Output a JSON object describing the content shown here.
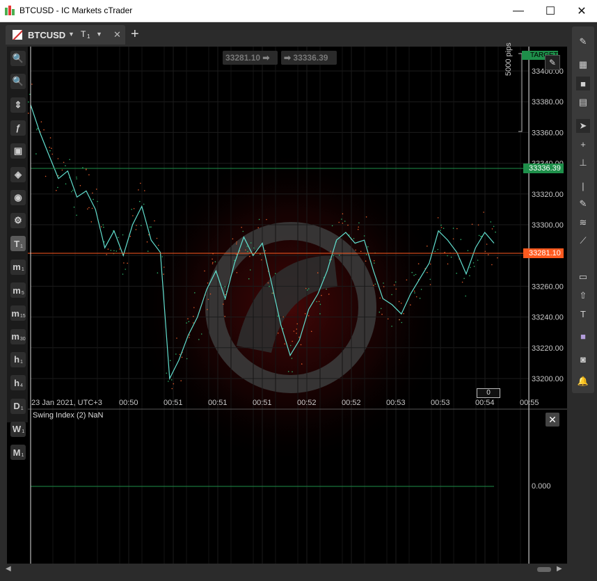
{
  "window": {
    "title": "BTCUSD - IC Markets cTrader",
    "minimize_glyph": "—",
    "maximize_glyph": "☐",
    "close_glyph": "✕"
  },
  "tabs": {
    "active": {
      "symbol": "BTCUSD",
      "timeframe": "T",
      "timeframe_sub": "1"
    },
    "add_label": "+"
  },
  "chart": {
    "bid_price_label": "33281.10",
    "ask_price_label": "33336.39",
    "pips_label": "5000 pips",
    "target_label": "TARGETS",
    "bid_line_color": "#ff5a1f",
    "ask_line_color": "#1e8f4a",
    "countdown_label": "0",
    "y_ticks": [
      "33400.00",
      "33380.00",
      "33360.00",
      "33340.00",
      "33320.00",
      "33300.00",
      "33280.00",
      "33260.00",
      "33240.00",
      "33220.00",
      "33200.00"
    ],
    "x_ticks": [
      "23 Jan 2021, UTC+3",
      "00:50",
      "00:51",
      "00:51",
      "00:51",
      "00:52",
      "00:52",
      "00:53",
      "00:53",
      "00:54",
      "00:55"
    ]
  },
  "indicator": {
    "label": "Swing Index (2) NaN",
    "zero_label": "0.000",
    "close_glyph": "✕"
  },
  "left_toolbar": [
    {
      "name": "zoom-in-icon",
      "label": "🔍",
      "sub": ""
    },
    {
      "name": "zoom-out-icon",
      "label": "🔍",
      "sub": ""
    },
    {
      "name": "chart-type-icon",
      "label": "⇕",
      "sub": ""
    },
    {
      "name": "indicators-icon",
      "label": "ƒ",
      "sub": ""
    },
    {
      "name": "robot-icon",
      "label": "▣",
      "sub": ""
    },
    {
      "name": "layers-icon",
      "label": "◈",
      "sub": ""
    },
    {
      "name": "eye-icon",
      "label": "◉",
      "sub": ""
    },
    {
      "name": "settings-icon",
      "label": "⚙",
      "sub": ""
    },
    {
      "name": "timeframe-t1",
      "label": "T",
      "sub": "1"
    },
    {
      "name": "timeframe-m1",
      "label": "m",
      "sub": "1"
    },
    {
      "name": "timeframe-m5",
      "label": "m",
      "sub": "5"
    },
    {
      "name": "timeframe-m15",
      "label": "m",
      "sub": "15"
    },
    {
      "name": "timeframe-m30",
      "label": "m",
      "sub": "30"
    },
    {
      "name": "timeframe-h1",
      "label": "h",
      "sub": "1"
    },
    {
      "name": "timeframe-h4",
      "label": "h",
      "sub": "4"
    },
    {
      "name": "timeframe-d1",
      "label": "D",
      "sub": "1"
    },
    {
      "name": "timeframe-w1",
      "label": "W",
      "sub": "1"
    },
    {
      "name": "timeframe-mn1",
      "label": "M",
      "sub": "1"
    }
  ],
  "right_toolbar": [
    {
      "name": "edit-layout-icon",
      "label": "✎"
    },
    {
      "name": "grid-layout-icon",
      "label": "▦"
    },
    {
      "name": "single-layout-icon",
      "label": "■"
    },
    {
      "name": "split-layout-icon",
      "label": "▤"
    },
    {
      "name": "cursor-icon",
      "label": "➤"
    },
    {
      "name": "crosshair-icon",
      "label": "+"
    },
    {
      "name": "measure-icon",
      "label": "⊥"
    },
    {
      "name": "vertical-line-icon",
      "label": "|"
    },
    {
      "name": "pen-icon",
      "label": "✎"
    },
    {
      "name": "fibonacci-icon",
      "label": "≋"
    },
    {
      "name": "trendline-icon",
      "label": "⟋"
    },
    {
      "name": "rectangle-icon",
      "label": "▭"
    },
    {
      "name": "arrow-icon",
      "label": "⇧"
    },
    {
      "name": "text-icon",
      "label": "T"
    },
    {
      "name": "color-icon",
      "label": "■"
    },
    {
      "name": "camera-icon",
      "label": "◙"
    },
    {
      "name": "bell-icon",
      "label": "🔔"
    }
  ],
  "chart_data": {
    "type": "line",
    "series": [
      {
        "values": [
          33378,
          33360,
          33345,
          33330,
          33335,
          33318,
          33322,
          33310,
          33285,
          33296,
          33280,
          33300,
          33312,
          33290,
          33282,
          33200,
          33212,
          33228,
          33240,
          33258,
          33270,
          33252,
          33275,
          33292,
          33280,
          33288,
          33262,
          33235,
          33215,
          33225,
          33245,
          33255,
          33270,
          33290,
          33295,
          33288,
          33290,
          33270,
          33252,
          33248,
          33242,
          33255,
          33265,
          33275,
          33296,
          33290,
          33282,
          33268,
          33285,
          33295,
          33288
        ]
      }
    ],
    "ylim": [
      33190,
      33410
    ]
  }
}
